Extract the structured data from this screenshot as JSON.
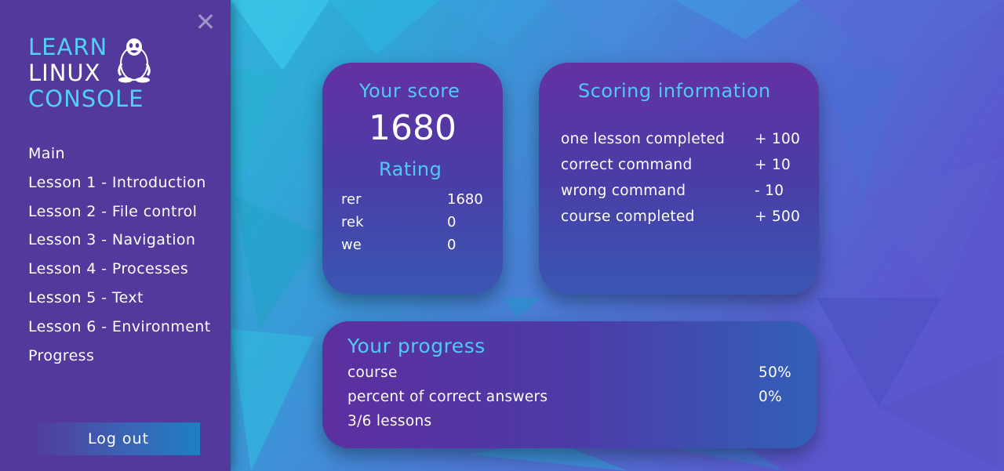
{
  "logo": {
    "line1": "LEARN",
    "line2": "LINUX",
    "line3": "CONSOLE"
  },
  "close_label": "✕",
  "menu": [
    {
      "label": "Main"
    },
    {
      "label": "Lesson 1 - Introduction"
    },
    {
      "label": "Lesson 2 - File control"
    },
    {
      "label": "Lesson 3 - Navigation"
    },
    {
      "label": "Lesson 4 - Processes"
    },
    {
      "label": "Lesson 5 - Text"
    },
    {
      "label": "Lesson 6 - Environment"
    },
    {
      "label": "Progress"
    }
  ],
  "logout_label": "Log out",
  "score_card": {
    "title": "Your score",
    "value": "1680",
    "rating_title": "Rating",
    "rating": [
      {
        "name": "rer",
        "value": "1680"
      },
      {
        "name": "rek",
        "value": "0"
      },
      {
        "name": "we",
        "value": "0"
      }
    ]
  },
  "scoring_card": {
    "title": "Scoring information",
    "rows": [
      {
        "label": "one lesson completed",
        "value": "+ 100"
      },
      {
        "label": "correct command",
        "value": "+ 10"
      },
      {
        "label": "wrong command",
        "value": "- 10"
      },
      {
        "label": "course completed",
        "value": "+ 500"
      }
    ]
  },
  "progress_card": {
    "title": "Your progress",
    "rows": [
      {
        "label": "course",
        "value": "50%"
      },
      {
        "label": "percent of correct answers",
        "value": "0%"
      },
      {
        "label": "3/6 lessons",
        "value": ""
      }
    ]
  },
  "colors": {
    "sidebar": "#53399c",
    "accent": "#4fcbf3",
    "background_light": "#40d3f0",
    "background_dark": "#5a5ad0"
  },
  "icons": {
    "logo": "tux-penguin-icon",
    "close": "close-icon"
  }
}
